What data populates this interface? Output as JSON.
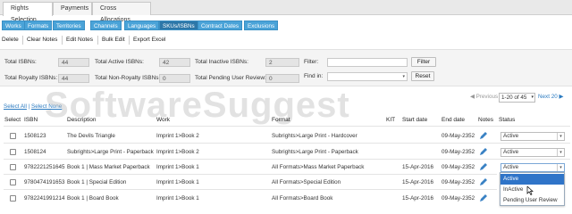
{
  "top_tabs": [
    "Rights Selection",
    "Payments",
    "Cross Allocations"
  ],
  "sub_tabs": [
    "Works",
    "Formats",
    "Territories",
    "Channels",
    "Languages",
    "SKUs/ISBNs",
    "Contract Dates",
    "Exclusions"
  ],
  "toolbar": [
    "Delete",
    "Clear Notes",
    "Edit Notes",
    "Bulk Edit",
    "Export Excel"
  ],
  "stats": {
    "total_isbns_label": "Total ISBNs:",
    "total_isbns": "44",
    "total_active_label": "Total Active ISBNs:",
    "total_active": "42",
    "total_inactive_label": "Total Inactive ISBNs:",
    "total_inactive": "2",
    "total_royalty_label": "Total Royalty ISBNs:",
    "total_royalty": "44",
    "total_nonroyalty_label": "Total Non-Royalty ISBNs:",
    "total_nonroyalty": "0",
    "total_pending_label": "Total Pending User Review:",
    "total_pending": "0",
    "filter_label": "Filter:",
    "filter_button": "Filter",
    "findin_label": "Find in:",
    "reset_button": "Reset"
  },
  "pagination": {
    "previous": "Previous",
    "range": "1-20 of 45",
    "next": "Next 20"
  },
  "select_all": "Select All",
  "select_none": "Select None",
  "table": {
    "headers": [
      "Select",
      "ISBN",
      "Description",
      "Work",
      "Format",
      "KIT",
      "Start date",
      "End date",
      "Notes",
      "Status"
    ],
    "rows": [
      {
        "isbn": "1508123",
        "description": "The Devils Triangle",
        "work": "Imprint 1>Book 2",
        "format": "Subrights>Large Print - Hardcover",
        "start": "",
        "end": "09-May-2352",
        "status": "Active"
      },
      {
        "isbn": "1508124",
        "description": "Subrights>Large Print - Paperback",
        "work": "Imprint 1>Book 2",
        "format": "Subrights>Large Print - Paperback",
        "start": "",
        "end": "09-May-2352",
        "status": "Active"
      },
      {
        "isbn": "9782221251645",
        "description": "Book 1 | Mass Market Paperback",
        "work": "Imprint 1>Book 1",
        "format": "All Formats>Mass Market Paperback",
        "start": "15-Apr-2016",
        "end": "09-May-2352",
        "status": "Active"
      },
      {
        "isbn": "9780474191653",
        "description": "Book 1 | Special Edition",
        "work": "Imprint 1>Book 1",
        "format": "All Formats>Special Edition",
        "start": "15-Apr-2016",
        "end": "09-May-2352",
        "status": ""
      },
      {
        "isbn": "9782241991214",
        "description": "Book 1 | Board Book",
        "work": "Imprint 1>Book 1",
        "format": "All Formats>Board Book",
        "start": "15-Apr-2016",
        "end": "09-May-2352",
        "status": ""
      }
    ]
  },
  "status_dropdown": [
    "Active",
    "InActive",
    "Pending User Review"
  ],
  "watermark": "SoftwareSuggest",
  "colors": {
    "tab_blue": "#4aa3d8",
    "tab_active": "#2d77a8",
    "link": "#2a7ac0",
    "dropdown_highlight": "#2f74c8"
  },
  "icons": {
    "notes": "pencil-icon",
    "pagination_prev": "chevron-left-icon",
    "pagination_next": "chevron-right-icon",
    "select_arrow": "chevron-down-icon"
  }
}
